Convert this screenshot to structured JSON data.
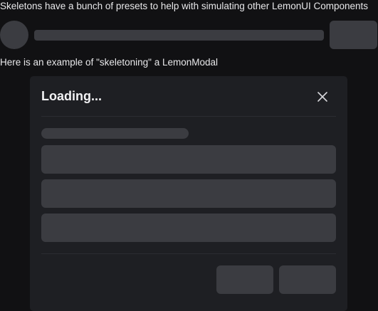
{
  "intro": {
    "description": "Skeletons have a bunch of presets to help with simulating other LemonUI Components"
  },
  "example": {
    "caption": "Here is an example of \"skeletoning\" a LemonModal"
  },
  "modal": {
    "title": "Loading...",
    "close_icon": "close-icon"
  },
  "colors": {
    "background": "#111113",
    "modal_background": "#1e1f23",
    "skeleton": "#3b3c41",
    "text": "#e8e8ea"
  }
}
